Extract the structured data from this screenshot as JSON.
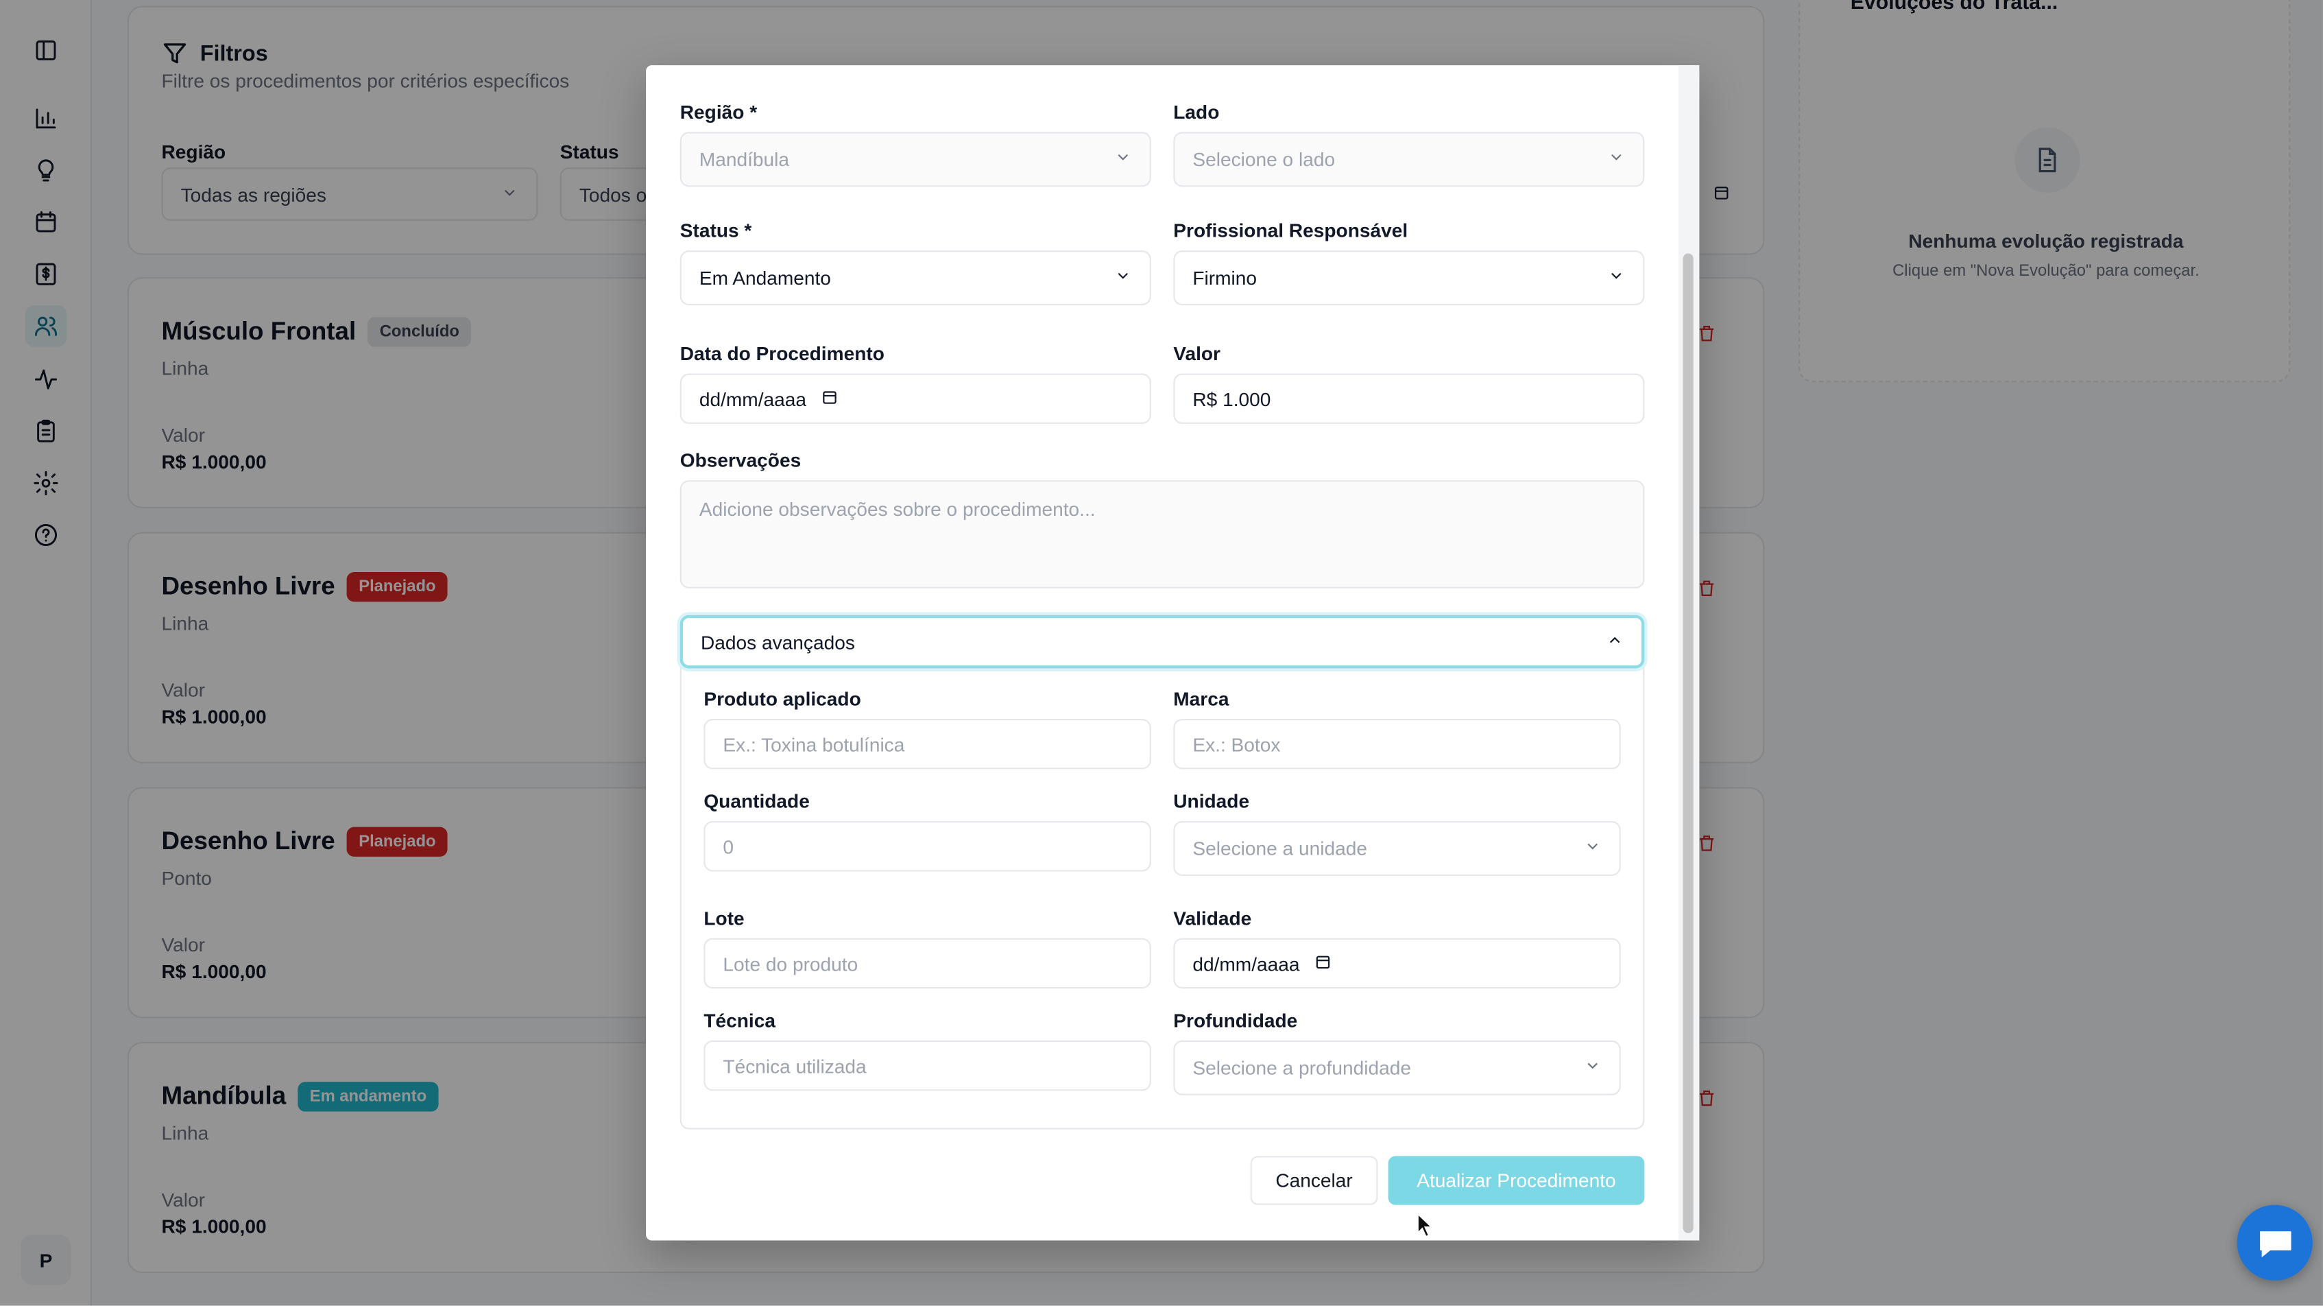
{
  "sidebar": {
    "user_initial": "P",
    "icons": [
      "panel-toggle-icon",
      "bar-chart-icon",
      "lightbulb-icon",
      "calendar-icon",
      "dollar-icon",
      "users-icon",
      "activity-icon",
      "clipboard-icon",
      "gear-icon",
      "help-icon"
    ]
  },
  "filters": {
    "title": "Filtros",
    "subtitle": "Filtre os procedimentos por critérios específicos",
    "region_label": "Região",
    "region_value": "Todas as regiões",
    "status_label": "Status",
    "status_value": "Todos os"
  },
  "procedures": [
    {
      "title": "Músculo Frontal",
      "badge": "Concluído",
      "type": "Linha",
      "value_label": "Valor",
      "value": "R$ 1.000,00"
    },
    {
      "title": "Desenho Livre",
      "badge": "Planejado",
      "type": "Linha",
      "value_label": "Valor",
      "value": "R$ 1.000,00"
    },
    {
      "title": "Desenho Livre",
      "badge": "Planejado",
      "type": "Ponto",
      "value_label": "Valor",
      "value": "R$ 1.000,00"
    },
    {
      "title": "Mandíbula",
      "badge": "Em andamento",
      "type": "Linha",
      "value_label": "Valor",
      "value": "R$ 1.000,00"
    }
  ],
  "evolutions": {
    "header": "Evoluções do Trata...",
    "count": "0",
    "empty_title": "Nenhuma evolução registrada",
    "empty_subtitle": "Clique em \"Nova Evolução\" para começar."
  },
  "modal": {
    "region_label": "Região *",
    "region_value": "Mandíbula",
    "side_label": "Lado",
    "side_placeholder": "Selecione o lado",
    "status_label": "Status *",
    "status_value": "Em Andamento",
    "professional_label": "Profissional Responsável",
    "professional_value": "Firmino",
    "date_label": "Data do Procedimento",
    "date_value": "dd/mm/aaaa",
    "value_label": "Valor",
    "value_value": "R$ 1.000",
    "notes_label": "Observações",
    "notes_placeholder": "Adicione observações sobre o procedimento...",
    "advanced_label": "Dados avançados",
    "product_label": "Produto aplicado",
    "product_placeholder": "Ex.: Toxina botulínica",
    "brand_label": "Marca",
    "brand_placeholder": "Ex.: Botox",
    "quantity_label": "Quantidade",
    "quantity_placeholder": "0",
    "unit_label": "Unidade",
    "unit_placeholder": "Selecione a unidade",
    "batch_label": "Lote",
    "batch_placeholder": "Lote do produto",
    "validity_label": "Validade",
    "validity_value": "dd/mm/aaaa",
    "technique_label": "Técnica",
    "technique_placeholder": "Técnica utilizada",
    "depth_label": "Profundidade",
    "depth_placeholder": "Selecione a profundidade",
    "cancel_label": "Cancelar",
    "submit_label": "Atualizar Procedimento"
  },
  "colors": {
    "accent": "#22b8cf",
    "danger": "#dc2626",
    "chat": "#1d74d8"
  }
}
